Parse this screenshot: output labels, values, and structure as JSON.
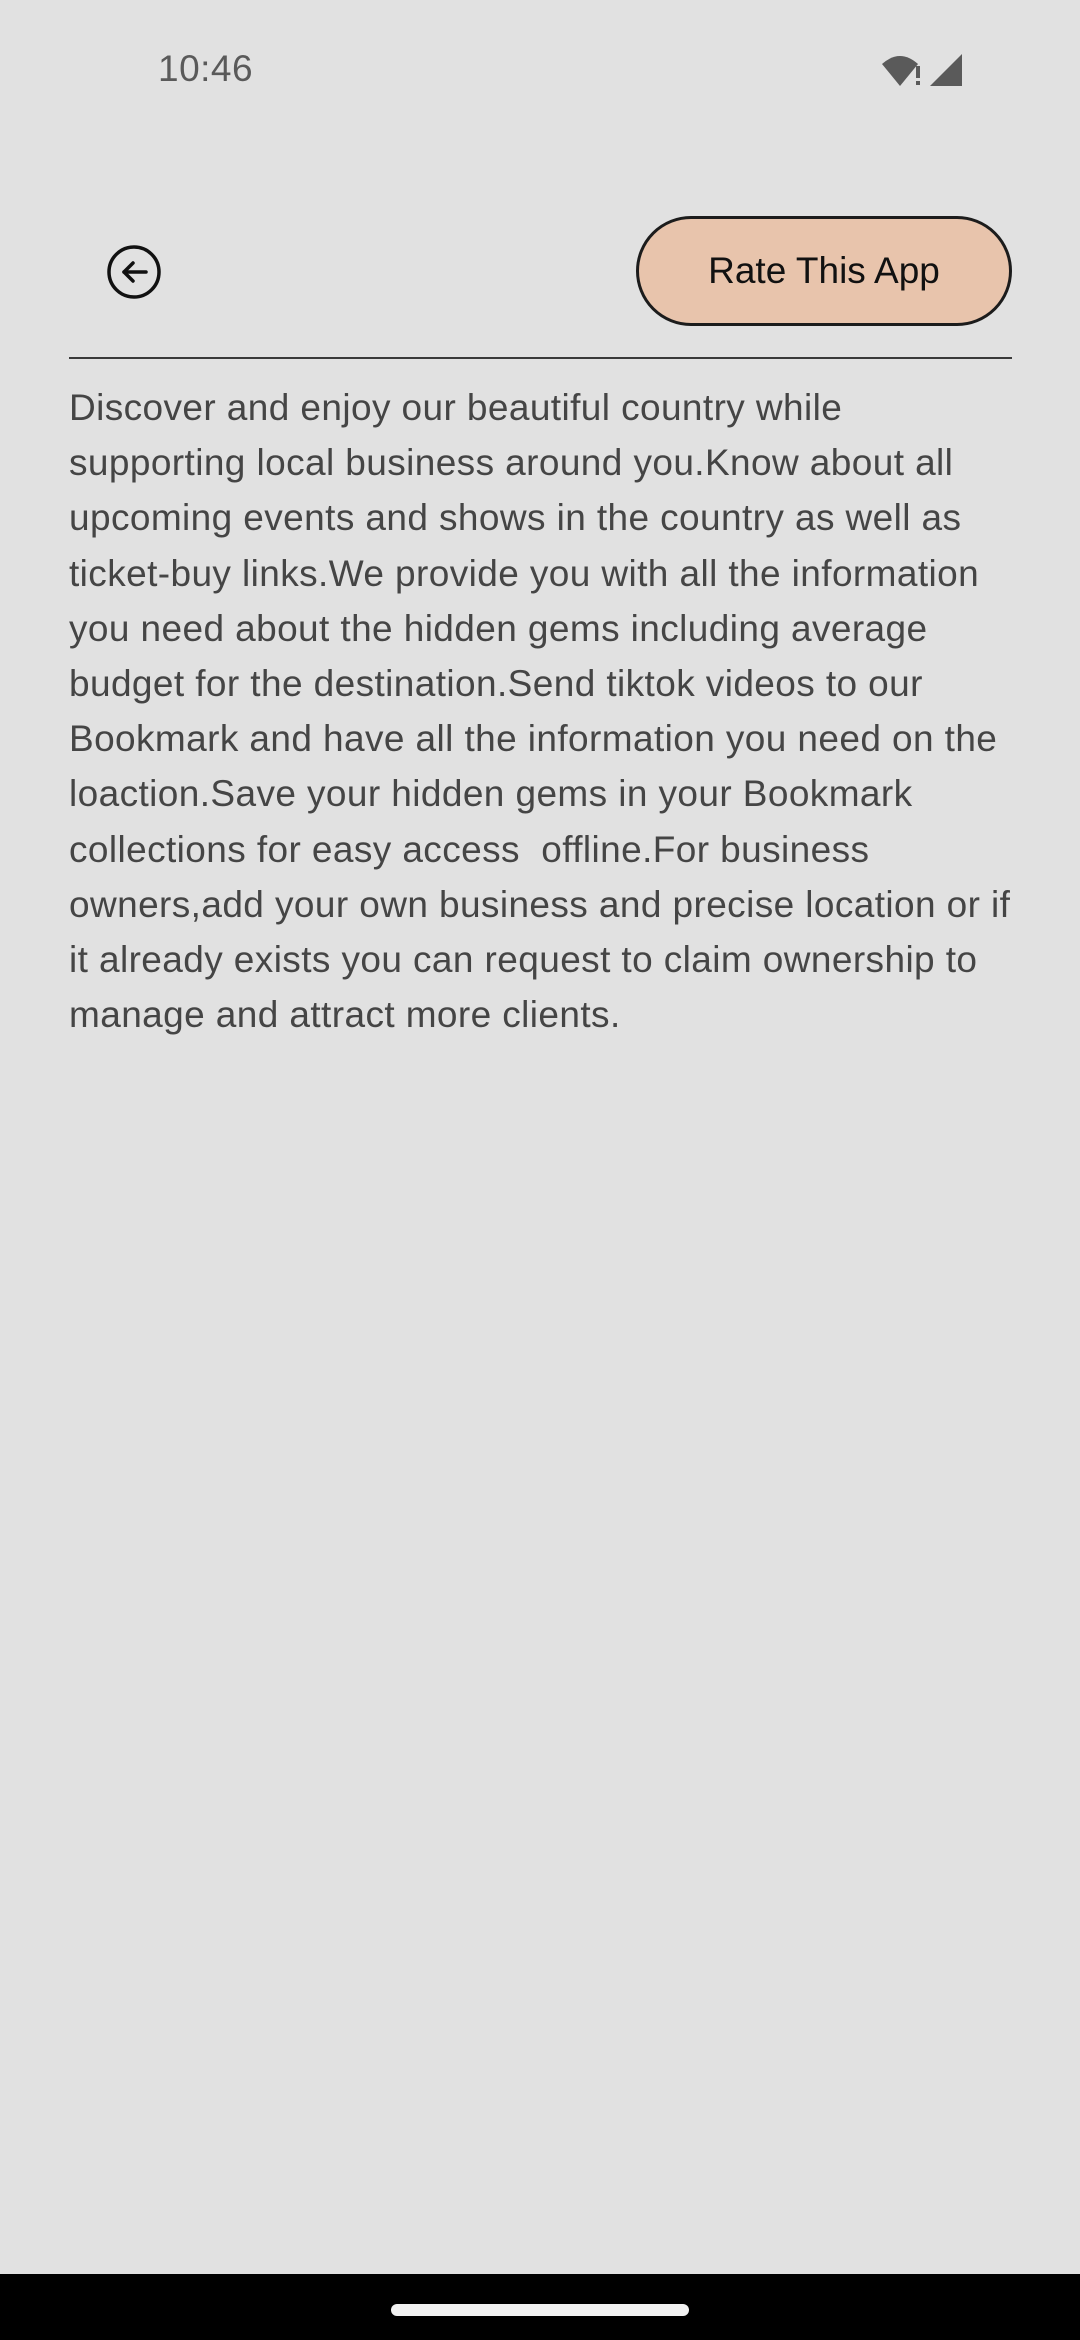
{
  "status_bar": {
    "time": "10:46",
    "icons": [
      "wifi-alert-icon",
      "cellular-signal-icon"
    ]
  },
  "header": {
    "back_icon": "arrow-left-circle-icon",
    "rate_button_label": "Rate This App",
    "rate_button_color": "#e8c4ac"
  },
  "description": {
    "text": "Discover and enjoy our beautiful country while supporting local business around you.Know about all upcoming events and shows in the country as well as ticket-buy links.We provide you with all the information you need about the hidden gems including average budget for the destination.Send tiktok videos to our Bookmark and have all the information you need on the loaction.Save your hidden gems in your Bookmark collections for easy access  offline.For business owners,add your own business and precise location or if it already exists you can request to claim ownership to manage and attract more clients."
  },
  "colors": {
    "background": "#e1e1e1",
    "text": "#454545",
    "accent": "#e8c4ac"
  }
}
